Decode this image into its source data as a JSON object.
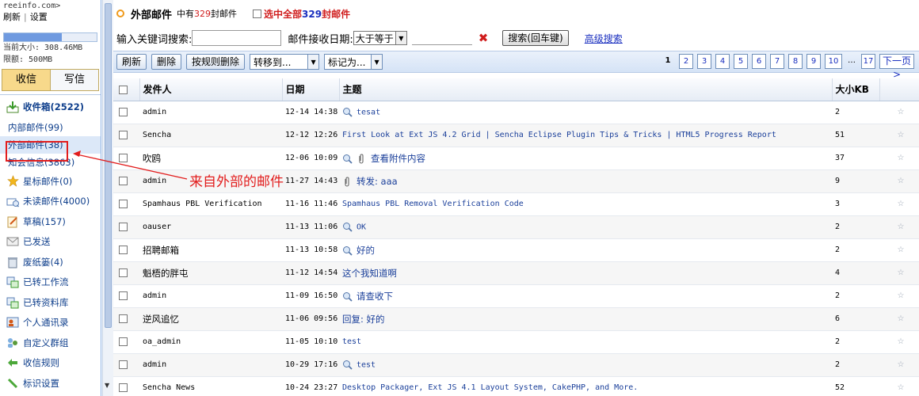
{
  "sidebar": {
    "domain": "reeinfo.com>",
    "refresh": "刷新",
    "separator": "|",
    "settings": "设置",
    "quota_used_fraction": 0.62,
    "quota_current": "当前大小: 308.46MB",
    "quota_limit": "限额: 500MB",
    "tab_receive": "收信",
    "tab_compose": "写信",
    "folders": [
      {
        "label": "收件箱(2522)",
        "icon": "inbox-download-icon"
      },
      {
        "label": "内部邮件(99)"
      },
      {
        "label": "外部邮件(38)"
      },
      {
        "label": "知会信息(3863)"
      },
      {
        "label": "星标邮件(0)",
        "icon": "star-icon"
      },
      {
        "label": "未读邮件(4000)",
        "icon": "unread-mail-icon"
      },
      {
        "label": "草稿(157)",
        "icon": "draft-icon"
      },
      {
        "label": "已发送",
        "icon": "sent-icon"
      },
      {
        "label": "废纸篓(4)",
        "icon": "trash-icon"
      },
      {
        "label": "已转工作流",
        "icon": "workflow-icon"
      },
      {
        "label": "已转资料库",
        "icon": "library-icon"
      },
      {
        "label": "个人通讯录",
        "icon": "contacts-icon"
      },
      {
        "label": "自定义群组",
        "icon": "group-icon"
      },
      {
        "label": "收信规则",
        "icon": "rules-icon"
      },
      {
        "label": "标识设置",
        "icon": "settings-icon"
      }
    ]
  },
  "header": {
    "title": "外部邮件",
    "count_prefix": "中有",
    "count_value": "329",
    "count_suffix": "封邮件",
    "select_all_prefix": "选中全部",
    "select_all_value": "329",
    "select_all_suffix": "封邮件"
  },
  "search": {
    "keyword_label": "输入关键词搜索:",
    "keyword_value": "",
    "date_label": "邮件接收日期:",
    "date_operator": "大于等于",
    "date_value": "",
    "search_button": "搜索(回车键)",
    "advanced_link": "高级搜索"
  },
  "toolbar": {
    "refresh": "刷新",
    "delete": "删除",
    "delete_by_rule": "按规则删除",
    "move_to": "转移到...",
    "mark_as": "标记为..."
  },
  "pager": {
    "current": "1",
    "pages": [
      "2",
      "3",
      "4",
      "5",
      "6",
      "7",
      "8",
      "9",
      "10"
    ],
    "ellipsis": "…",
    "last": "17",
    "next": "下一页>"
  },
  "columns": {
    "sender": "发件人",
    "date": "日期",
    "subject": "主题",
    "size": "大小KB"
  },
  "rows": [
    {
      "sender": "admin",
      "date": "12-14 14:38",
      "subject": "tesat",
      "size": "2",
      "icon": "search"
    },
    {
      "sender": "Sencha",
      "date": "12-12 12:26",
      "subject": "First Look at Ext JS 4.2 Grid | Sencha Eclipse Plugin Tips & Tricks | HTML5 Progress Report",
      "size": "51",
      "icon": ""
    },
    {
      "sender": "吹鸥",
      "date": "12-06 10:09",
      "subject": "查看附件内容",
      "size": "37",
      "icon": "search+clip"
    },
    {
      "sender": "admin",
      "date": "11-27 14:43",
      "subject": "转发: aaa",
      "size": "9",
      "icon": "clip"
    },
    {
      "sender": "Spamhaus PBL Verification",
      "date": "11-16 11:46",
      "subject": "Spamhaus PBL Removal Verification Code",
      "size": "3",
      "icon": ""
    },
    {
      "sender": "oauser",
      "date": "11-13 11:06",
      "subject": "OK",
      "size": "2",
      "icon": "search"
    },
    {
      "sender": "招聘邮箱",
      "date": "11-13 10:58",
      "subject": "好的",
      "size": "2",
      "icon": "search"
    },
    {
      "sender": "魁梧的胖屯",
      "date": "11-12 14:54",
      "subject": "这个我知道啊",
      "size": "4",
      "icon": ""
    },
    {
      "sender": "admin",
      "date": "11-09 16:50",
      "subject": "请查收下",
      "size": "2",
      "icon": "search"
    },
    {
      "sender": "逆风追忆",
      "date": "11-06 09:56",
      "subject": "回复: 好的",
      "size": "6",
      "icon": ""
    },
    {
      "sender": "oa_admin",
      "date": "11-05 10:10",
      "subject": "test",
      "size": "2",
      "icon": ""
    },
    {
      "sender": "admin",
      "date": "10-29 17:16",
      "subject": "test",
      "size": "2",
      "icon": "search"
    },
    {
      "sender": "Sencha News",
      "date": "10-24 23:27",
      "subject": "Desktop Packager, Ext JS 4.1 Layout System, CakePHP, and More.",
      "size": "52",
      "icon": ""
    }
  ],
  "annotation": {
    "text": "来自外部的邮件",
    "color": "#e21d1d"
  },
  "colors": {
    "link": "#1a2fbf",
    "accent_red": "#d01d1d",
    "toolbar_bg": "#d5e3f6"
  }
}
